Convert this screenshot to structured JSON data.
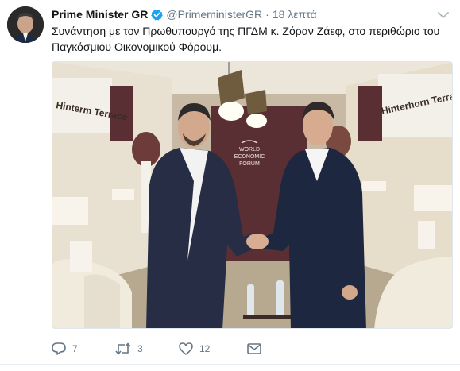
{
  "tweet": {
    "author_name": "Prime Minister GR",
    "handle": "@PrimeministerGR",
    "separator": "·",
    "timestamp": "18 λεπτά",
    "text": "Συνάντηση με τον Πρωθυπουργό της ΠΓΔΜ κ. Ζόραν Ζάεφ, στο περιθώριο του Παγκόσμιου Οικονομικού Φόρουμ."
  },
  "photo": {
    "wall_sign_left": "Hinterm Terrace",
    "wall_sign_right": "Hinterhorn Terrace",
    "backdrop_logo": [
      "WORLD",
      "ECONOMIC",
      "FORUM"
    ]
  },
  "actions": {
    "replies": "7",
    "retweets": "3",
    "likes": "12"
  },
  "colors": {
    "verified": "#1da1f2",
    "secondary_text": "#657786",
    "primary_text": "#14171a"
  }
}
